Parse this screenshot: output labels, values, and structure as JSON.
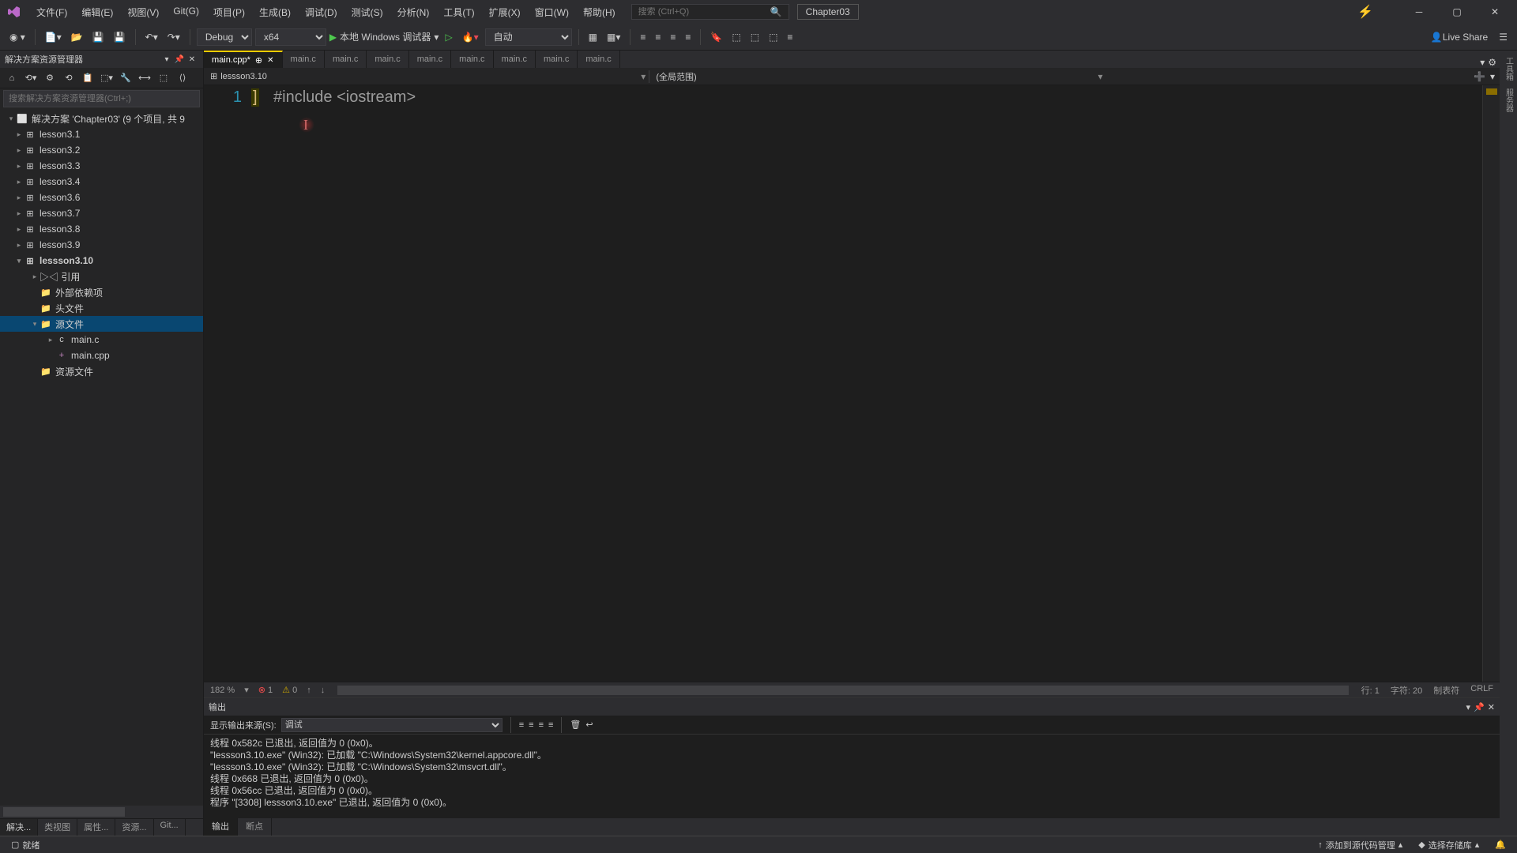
{
  "title_menu": [
    "文件(F)",
    "编辑(E)",
    "视图(V)",
    "Git(G)",
    "项目(P)",
    "生成(B)",
    "调试(D)",
    "测试(S)",
    "分析(N)",
    "工具(T)",
    "扩展(X)",
    "窗口(W)",
    "帮助(H)"
  ],
  "search": {
    "placeholder": "搜索 (Ctrl+Q)"
  },
  "project_name": "Chapter03",
  "toolbar": {
    "config": "Debug",
    "platform": "x64",
    "run_label": "本地 Windows 调试器",
    "mode": "自动",
    "liveshare": "Live Share"
  },
  "solution_explorer": {
    "title": "解决方案资源管理器",
    "search_placeholder": "搜索解决方案资源管理器(Ctrl+;)",
    "root": "解决方案 'Chapter03' (9 个项目, 共 9",
    "projects": [
      "lesson3.1",
      "lesson3.2",
      "lesson3.3",
      "lesson3.4",
      "lesson3.6",
      "lesson3.7",
      "lesson3.8",
      "lesson3.9"
    ],
    "active_project": "lessson3.10",
    "active_children": {
      "refs": "▷◁ 引用",
      "external": "外部依赖项",
      "headers": "头文件",
      "sources": "源文件",
      "source_files": [
        "main.c",
        "main.cpp"
      ],
      "resources": "资源文件"
    },
    "tabs": [
      "解决...",
      "类视图",
      "属性...",
      "资源...",
      "Git..."
    ]
  },
  "editor": {
    "tabs": [
      "main.cpp*",
      "main.c",
      "main.c",
      "main.c",
      "main.c",
      "main.c",
      "main.c",
      "main.c",
      "main.c"
    ],
    "nav_left": "lessson3.10",
    "nav_right": "(全局范围)",
    "line_number": "1",
    "code_line": "#include <iostream>",
    "status": {
      "zoom": "182 %",
      "errors": "1",
      "warnings": "0",
      "line": "行: 1",
      "char": "字符: 20",
      "tabs_mode": "制表符",
      "eol": "CRLF"
    }
  },
  "output": {
    "title": "输出",
    "source_label": "显示输出来源(S):",
    "source_value": "调试",
    "lines": [
      "线程 0x582c 已退出, 返回值为 0 (0x0)。",
      "\"lessson3.10.exe\" (Win32): 已加载 \"C:\\Windows\\System32\\kernel.appcore.dll\"。",
      "\"lessson3.10.exe\" (Win32): 已加载 \"C:\\Windows\\System32\\msvcrt.dll\"。",
      "线程 0x668 已退出, 返回值为 0 (0x0)。",
      "线程 0x56cc 已退出, 返回值为 0 (0x0)。",
      "程序 \"[3308] lessson3.10.exe\" 已退出, 返回值为 0 (0x0)。"
    ],
    "tabs": [
      "输出",
      "断点"
    ]
  },
  "statusbar": {
    "ready": "就绪",
    "source_control": "添加到源代码管理",
    "repo": "选择存储库"
  }
}
